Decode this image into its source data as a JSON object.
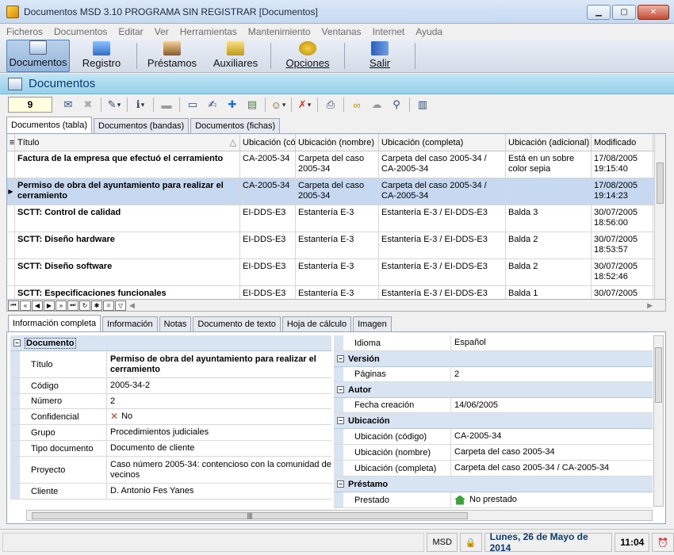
{
  "window": {
    "title": "Documentos MSD 3.10 PROGRAMA SIN REGISTRAR [Documentos]"
  },
  "menu": [
    "Ficheros",
    "Documentos",
    "Editar",
    "Ver",
    "Herramientas",
    "Mantenimiento",
    "Ventanas",
    "Internet",
    "Ayuda"
  ],
  "bigbar": {
    "documentos": "Documentos",
    "registro": "Registro",
    "prestamos": "Préstamos",
    "auxiliares": "Auxiliares",
    "opciones": "Opciones",
    "salir": "Salir"
  },
  "section": {
    "title": "Documentos"
  },
  "toolbar": {
    "count": "9"
  },
  "tabs": [
    "Documentos (tabla)",
    "Documentos (bandas)",
    "Documentos (fichas)"
  ],
  "grid": {
    "headers": [
      "Título",
      "Ubicación (có",
      "Ubicación (nombre)",
      "Ubicación (completa)",
      "Ubicación (adicional)",
      "Modificado"
    ],
    "rows": [
      [
        "Factura de la empresa que efectuó el cerramiento",
        "CA-2005-34",
        "Carpeta del caso 2005-34",
        "Carpeta del caso 2005-34 / CA-2005-34",
        "Está en un sobre color sepia",
        "17/08/2005 19:15:40"
      ],
      [
        "Permiso de obra del ayuntamiento para realizar el cerramiento",
        "CA-2005-34",
        "Carpeta del caso 2005-34",
        "Carpeta del caso 2005-34 / CA-2005-34",
        "",
        "17/08/2005 19:14:23"
      ],
      [
        "SCTT: Control de calidad",
        "EI-DDS-E3",
        "Estantería E-3",
        "Estantería E-3 / EI-DDS-E3",
        "Balda 3",
        "30/07/2005 18:56:00"
      ],
      [
        "SCTT: Diseño hardware",
        "EI-DDS-E3",
        "Estantería E-3",
        "Estantería E-3 / EI-DDS-E3",
        "Balda 2",
        "30/07/2005 18:53:57"
      ],
      [
        "SCTT: Diseño software",
        "EI-DDS-E3",
        "Estantería E-3",
        "Estantería E-3 / EI-DDS-E3",
        "Balda 2",
        "30/07/2005 18:52:46"
      ],
      [
        "SCTT: Especificaciones funcionales",
        "EI-DDS-E3",
        "Estantería E-3",
        "Estantería E-3 / EI-DDS-E3",
        "Balda 1",
        "30/07/2005"
      ]
    ]
  },
  "lowertabs": [
    "Información completa",
    "Información",
    "Notas",
    "Documento de texto",
    "Hoja de cálculo",
    "Imagen"
  ],
  "details": {
    "cat_documento": "Documento",
    "left": [
      [
        "Título",
        "Permiso de obra del ayuntamiento para realizar el cerramiento"
      ],
      [
        "Código",
        "2005-34-2"
      ],
      [
        "Número",
        "2"
      ],
      [
        "Confidencial",
        "No"
      ],
      [
        "Grupo",
        "Procedimientos judiciales"
      ],
      [
        "Tipo documento",
        "Documento de cliente"
      ],
      [
        "Proyecto",
        "Caso número 2005-34: contencioso con la comunidad de vecinos"
      ],
      [
        "Cliente",
        "D. Antonio Fes Yanes"
      ]
    ],
    "idioma_label": "Idioma",
    "idioma_value": "Español",
    "cat_version": "Versión",
    "paginas_label": "Páginas",
    "paginas_value": "2",
    "cat_autor": "Autor",
    "fecha_label": "Fecha creación",
    "fecha_value": "14/06/2005",
    "cat_ubicacion": "Ubicación",
    "ubic": [
      [
        "Ubicación (código)",
        "CA-2005-34"
      ],
      [
        "Ubicación (nombre)",
        "Carpeta del caso 2005-34"
      ],
      [
        "Ubicación (completa)",
        "Carpeta del caso 2005-34 / CA-2005-34"
      ]
    ],
    "cat_prestamo": "Préstamo",
    "prestado_label": "Prestado",
    "prestado_value": "No prestado"
  },
  "status": {
    "app": "MSD",
    "date": "Lunes, 26 de Mayo de 2014",
    "time": "11:04"
  }
}
